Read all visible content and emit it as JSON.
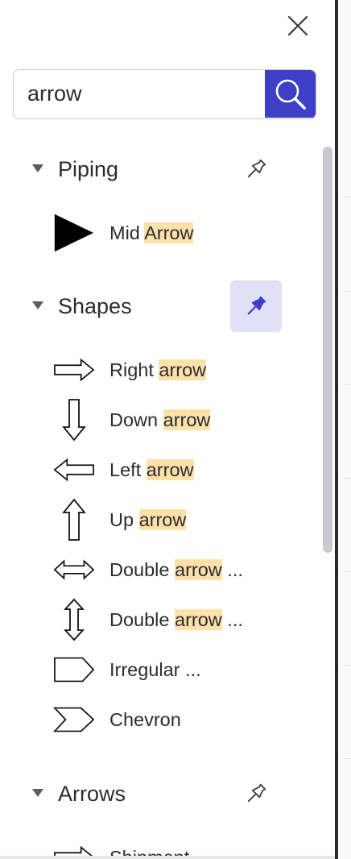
{
  "search": {
    "value": "arrow"
  },
  "sections": [
    {
      "title": "Piping",
      "pinned": false,
      "items": [
        {
          "pre": "Mid ",
          "match": "Arrow",
          "post": "",
          "icon": "triangle-icon"
        }
      ]
    },
    {
      "title": "Shapes",
      "pinned": true,
      "items": [
        {
          "pre": "Right ",
          "match": "arrow",
          "post": "",
          "icon": "right-arrow-icon"
        },
        {
          "pre": "Down ",
          "match": "arrow",
          "post": "",
          "icon": "down-arrow-icon"
        },
        {
          "pre": "Left ",
          "match": "arrow",
          "post": "",
          "icon": "left-arrow-icon"
        },
        {
          "pre": "Up ",
          "match": "arrow",
          "post": "",
          "icon": "up-arrow-icon"
        },
        {
          "pre": "Double ",
          "match": "arrow",
          "post": " ...",
          "icon": "double-horizontal-arrow-icon"
        },
        {
          "pre": "Double ",
          "match": "arrow",
          "post": " ...",
          "icon": "double-vertical-arrow-icon"
        },
        {
          "pre": "Irregular ...",
          "match": "",
          "post": "",
          "icon": "irregular-pentagon-icon"
        },
        {
          "pre": "Chevron",
          "match": "",
          "post": "",
          "icon": "chevron-icon"
        }
      ]
    },
    {
      "title": "Arrows",
      "pinned": false,
      "items": [
        {
          "pre": "Shipment ",
          "match": "",
          "post": "",
          "icon": "shipment-arrow-icon"
        }
      ]
    }
  ],
  "colors": {
    "accent": "#3d3fc7",
    "highlight": "#fde1a9",
    "pin_active_bg": "#e0e0f7"
  }
}
